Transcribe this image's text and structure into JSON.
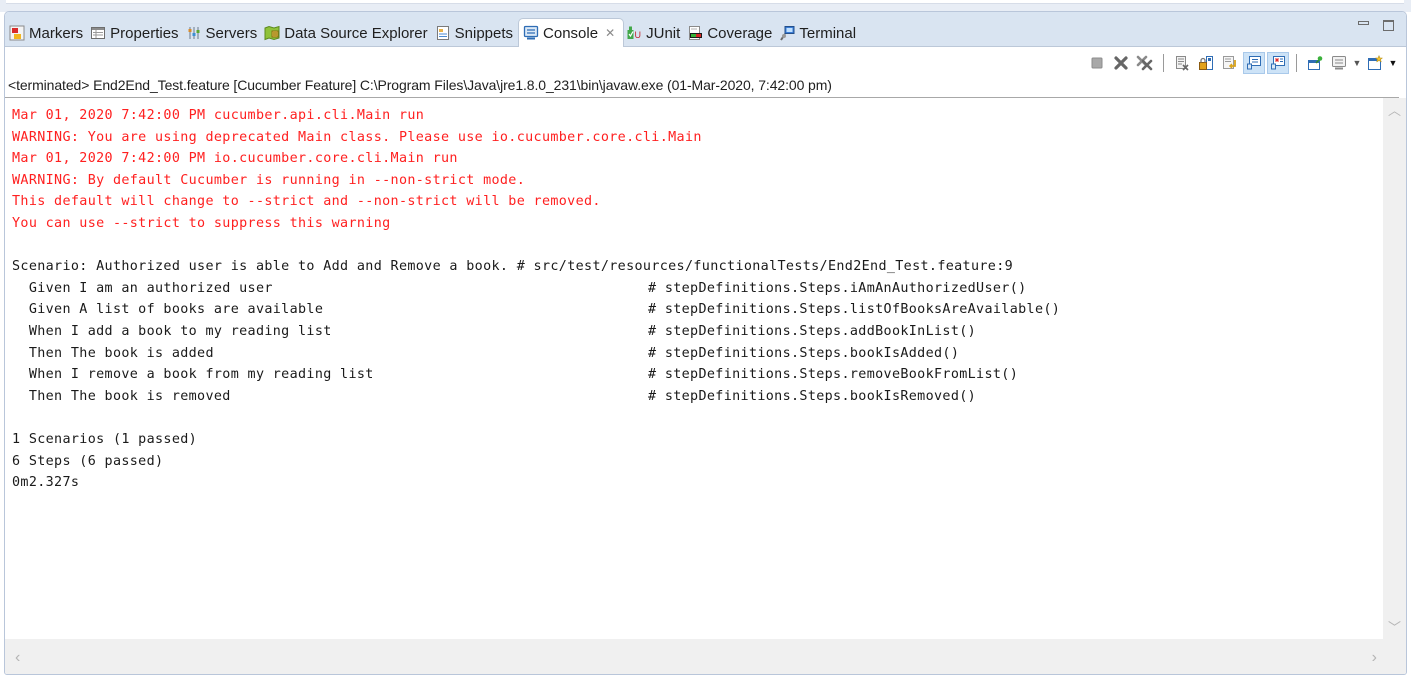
{
  "tabs": [
    {
      "label": "Markers",
      "icon": "markers-icon",
      "active": false
    },
    {
      "label": "Properties",
      "icon": "properties-icon",
      "active": false
    },
    {
      "label": "Servers",
      "icon": "servers-icon",
      "active": false
    },
    {
      "label": "Data Source Explorer",
      "icon": "data-source-explorer-icon",
      "active": false
    },
    {
      "label": "Snippets",
      "icon": "snippets-icon",
      "active": false
    },
    {
      "label": "Console",
      "icon": "console-icon",
      "active": true,
      "close": "✕"
    },
    {
      "label": "JUnit",
      "icon": "junit-icon",
      "active": false
    },
    {
      "label": "Coverage",
      "icon": "coverage-icon",
      "active": false
    },
    {
      "label": "Terminal",
      "icon": "terminal-icon",
      "active": false
    }
  ],
  "toolbar": {
    "buttons": [
      {
        "name": "terminate",
        "icon": "terminate-icon"
      },
      {
        "name": "remove-launch",
        "icon": "remove-launch-icon"
      },
      {
        "name": "remove-all-terminated",
        "icon": "remove-all-terminated-icon"
      },
      {
        "name": "clear-console",
        "icon": "clear-console-icon"
      },
      {
        "name": "scroll-lock",
        "icon": "scroll-lock-icon"
      },
      {
        "name": "word-wrap",
        "icon": "word-wrap-icon"
      },
      {
        "name": "show-console-on-stdout",
        "icon": "show-console-stdout-icon",
        "pressed": true
      },
      {
        "name": "show-console-on-stderr",
        "icon": "show-console-stderr-icon",
        "pressed": true
      },
      {
        "name": "pin-console",
        "icon": "pin-console-icon"
      },
      {
        "name": "display-selected-console",
        "icon": "display-console-icon"
      },
      {
        "name": "open-console",
        "icon": "open-console-icon"
      }
    ]
  },
  "colors": {
    "error_text": "#ff2020",
    "normal_text": "#1a1a1a",
    "tabbar_bg": "#d9e4f1"
  },
  "console": {
    "description": "<terminated> End2End_Test.feature [Cucumber Feature] C:\\Program Files\\Java\\jre1.8.0_231\\bin\\javaw.exe (01-Mar-2020, 7:42:00 pm)",
    "stderr_lines": [
      "Mar 01, 2020 7:42:00 PM cucumber.api.cli.Main run",
      "WARNING: You are using deprecated Main class. Please use io.cucumber.core.cli.Main",
      "Mar 01, 2020 7:42:00 PM io.cucumber.core.cli.Main run",
      "WARNING: By default Cucumber is running in --non-strict mode.",
      "This default will change to --strict and --non-strict will be removed.",
      "You can use --strict to suppress this warning"
    ],
    "scenario": {
      "text": "Scenario: Authorized user is able to Add and Remove a book.",
      "location": "# src/test/resources/functionalTests/End2End_Test.feature:9"
    },
    "steps": [
      {
        "text": "  Given I am an authorized user",
        "location": "# stepDefinitions.Steps.iAmAnAuthorizedUser()"
      },
      {
        "text": "  Given A list of books are available",
        "location": "# stepDefinitions.Steps.listOfBooksAreAvailable()"
      },
      {
        "text": "  When I add a book to my reading list",
        "location": "# stepDefinitions.Steps.addBookInList()"
      },
      {
        "text": "  Then The book is added",
        "location": "# stepDefinitions.Steps.bookIsAdded()"
      },
      {
        "text": "  When I remove a book from my reading list",
        "location": "# stepDefinitions.Steps.removeBookFromList()"
      },
      {
        "text": "  Then The book is removed",
        "location": "# stepDefinitions.Steps.bookIsRemoved()"
      }
    ],
    "summary": [
      "1 Scenarios (1 passed)",
      "6 Steps (6 passed)",
      "0m2.327s"
    ]
  }
}
